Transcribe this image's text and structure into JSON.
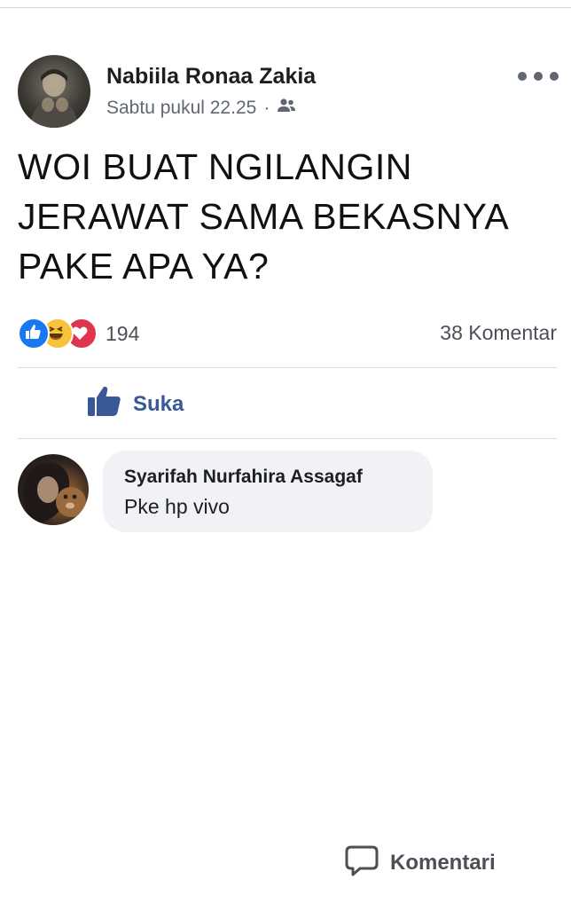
{
  "post": {
    "author": "Nabiila Ronaa Zakia",
    "timestamp": "Sabtu pukul 22.25",
    "separator": "·",
    "audience_icon": "friends-icon",
    "text": "WOI BUAT NGILANGIN\nJERAWAT SAMA BEKASNYA\nPAKE APA YA?"
  },
  "stats": {
    "reaction_icons": [
      "like-icon",
      "haha-icon",
      "love-icon"
    ],
    "reaction_count": "194",
    "comment_count": "38 Komentar"
  },
  "actions": {
    "like_label": "Suka",
    "comment_label": "Komentari"
  },
  "comment": {
    "author": "Syarifah Nurfahira Assagaf",
    "text": "Pke hp vivo"
  },
  "colors": {
    "like_blue": "#385898",
    "reaction_blue": "#1877f2",
    "reaction_red": "#e0334c",
    "haha_yellow": "#f7c33b",
    "bubble_bg": "#f0f2f5"
  }
}
